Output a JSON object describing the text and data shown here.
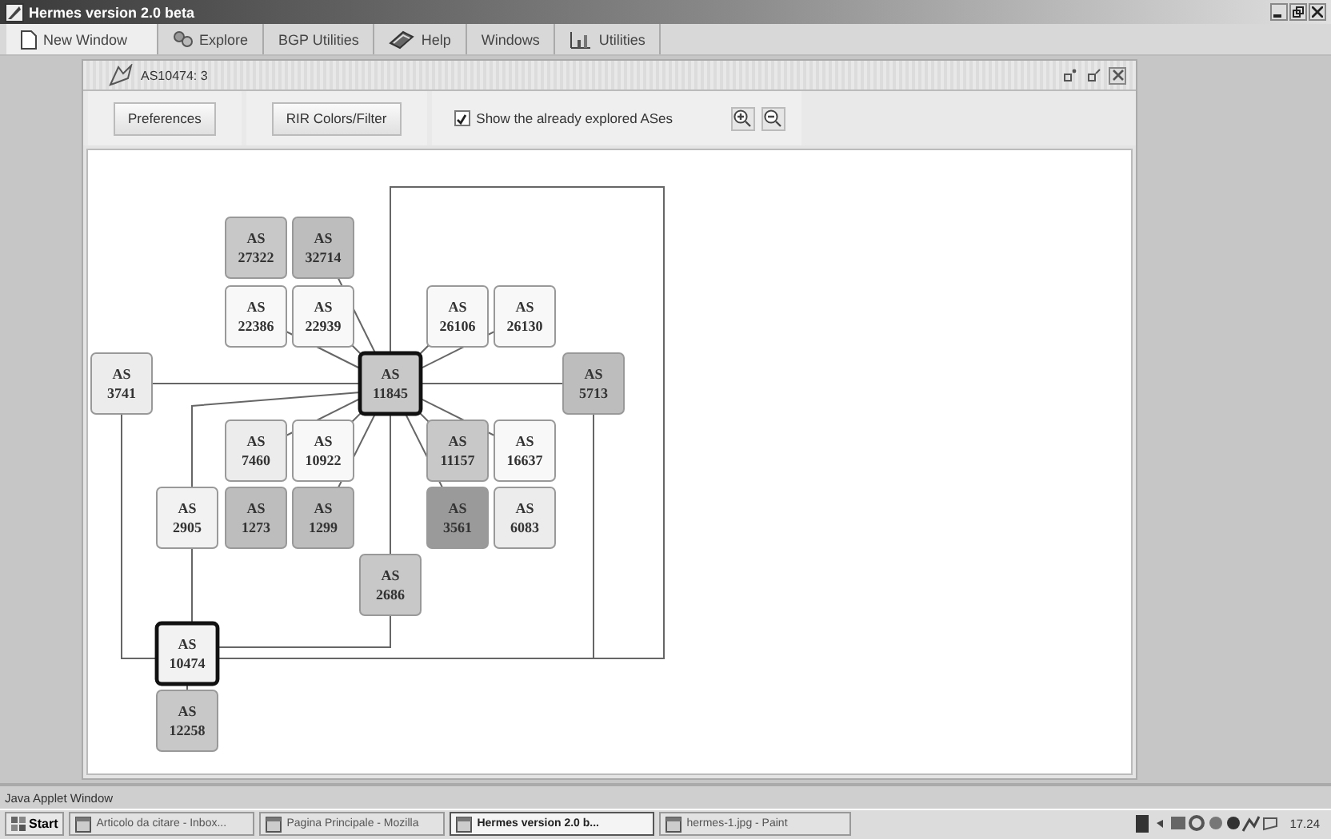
{
  "window": {
    "title": "Hermes version 2.0 beta"
  },
  "menu": [
    {
      "label": "New Window",
      "selected": true
    },
    {
      "label": "Explore",
      "selected": false
    },
    {
      "label": "BGP Utilities",
      "selected": false
    },
    {
      "label": "Help",
      "selected": false
    },
    {
      "label": "Windows",
      "selected": false
    },
    {
      "label": "Utilities",
      "selected": false
    }
  ],
  "inner_window": {
    "title": "AS10474: 3"
  },
  "toolbar": {
    "buttons": [
      "Preferences",
      "RIR Colors/Filter"
    ],
    "checkbox": {
      "label": "Show the already explored ASes",
      "checked": true
    }
  },
  "graph": {
    "nodes": [
      {
        "prefix": "AS",
        "asn": "27322",
        "color": "#c8c8c8",
        "selected": false
      },
      {
        "prefix": "AS",
        "asn": "32714",
        "color": "#bdbdbd",
        "selected": false
      },
      {
        "prefix": "AS",
        "asn": "22386",
        "color": "#f8f8f8",
        "selected": false
      },
      {
        "prefix": "AS",
        "asn": "22939",
        "color": "#f8f8f8",
        "selected": false
      },
      {
        "prefix": "AS",
        "asn": "26106",
        "color": "#f8f8f8",
        "selected": false
      },
      {
        "prefix": "AS",
        "asn": "26130",
        "color": "#f8f8f8",
        "selected": false
      },
      {
        "prefix": "AS",
        "asn": "3741",
        "color": "#ececec",
        "selected": false
      },
      {
        "prefix": "AS",
        "asn": "11845",
        "color": "#c8c8c8",
        "selected": true
      },
      {
        "prefix": "AS",
        "asn": "5713",
        "color": "#bdbdbd",
        "selected": false
      },
      {
        "prefix": "AS",
        "asn": "7460",
        "color": "#ececec",
        "selected": false
      },
      {
        "prefix": "AS",
        "asn": "10922",
        "color": "#f8f8f8",
        "selected": false
      },
      {
        "prefix": "AS",
        "asn": "11157",
        "color": "#c8c8c8",
        "selected": false
      },
      {
        "prefix": "AS",
        "asn": "16637",
        "color": "#f8f8f8",
        "selected": false
      },
      {
        "prefix": "AS",
        "asn": "2905",
        "color": "#f2f2f2",
        "selected": false
      },
      {
        "prefix": "AS",
        "asn": "1273",
        "color": "#bdbdbd",
        "selected": false
      },
      {
        "prefix": "AS",
        "asn": "1299",
        "color": "#bdbdbd",
        "selected": false
      },
      {
        "prefix": "AS",
        "asn": "3561",
        "color": "#9a9a9a",
        "selected": false
      },
      {
        "prefix": "AS",
        "asn": "6083",
        "color": "#ececec",
        "selected": false
      },
      {
        "prefix": "AS",
        "asn": "2686",
        "color": "#c8c8c8",
        "selected": false
      },
      {
        "prefix": "AS",
        "asn": "10474",
        "color": "#f2f2f2",
        "selected": true
      },
      {
        "prefix": "AS",
        "asn": "12258",
        "color": "#c8c8c8",
        "selected": false
      }
    ]
  },
  "status_bar": {
    "text": "Java Applet Window"
  },
  "taskbar": {
    "start": "Start",
    "items": [
      {
        "label": "Articolo da citare - Inbox...",
        "selected": false
      },
      {
        "label": "Pagina Principale - Mozilla",
        "selected": false
      },
      {
        "label": "Hermes version 2.0 b...",
        "selected": true
      },
      {
        "label": "hermes-1.jpg - Paint",
        "selected": false
      }
    ],
    "clock": "17.24"
  }
}
